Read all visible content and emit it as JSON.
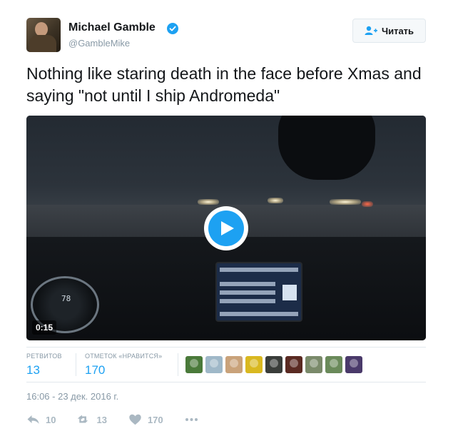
{
  "author": {
    "name": "Michael Gamble",
    "handle": "@GambleMike",
    "verified": true,
    "avatar_icon": "avatar-photo"
  },
  "follow_button": {
    "label": "Читать",
    "icon": "follow-user-icon"
  },
  "tweet": {
    "text": "Nothing like staring death in the face before Xmas and saying \"not until I ship Andromeda\""
  },
  "video": {
    "duration": "0:15",
    "play_icon": "play-icon",
    "dashboard_speed": "78"
  },
  "stats": {
    "retweets_label": "РЕТВИТОВ",
    "retweets_value": "13",
    "likes_label": "ОТМЕТОК «НРАВИТСЯ»",
    "likes_value": "170"
  },
  "likers": [
    {
      "color": "#4a7a3a"
    },
    {
      "color": "#9fb8c8"
    },
    {
      "color": "#c9a27a"
    },
    {
      "color": "#d9b820"
    },
    {
      "color": "#3a3d3a"
    },
    {
      "color": "#5a2a22"
    },
    {
      "color": "#7a8a6a"
    },
    {
      "color": "#6a8a5a"
    },
    {
      "color": "#4a3a6a"
    }
  ],
  "timestamp": "16:06 - 23 дек. 2016 г.",
  "actions": {
    "reply_count": "10",
    "retweet_count": "13",
    "like_count": "170"
  },
  "colors": {
    "accent": "#1da1f2",
    "muted": "#8899a6",
    "action_gray": "#aab8c2"
  }
}
